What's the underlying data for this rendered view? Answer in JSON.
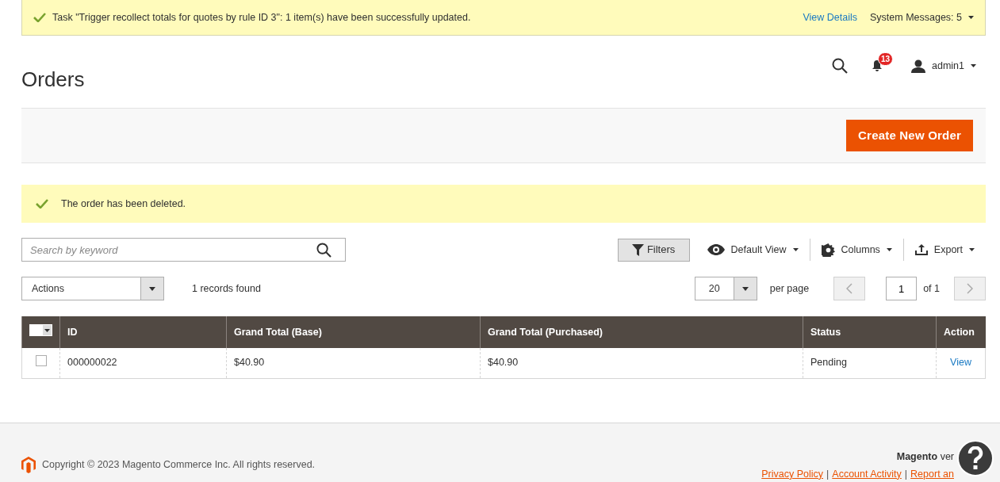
{
  "system_message": {
    "text": "Task \"Trigger recollect totals for quotes by rule ID 3\": 1 item(s) have been successfully updated.",
    "link": "View Details",
    "count_label": "System Messages: 5"
  },
  "header": {
    "title": "Orders",
    "notifications": "13",
    "user": "admin1"
  },
  "page_actions": [
    {
      "label": "Create New Order"
    }
  ],
  "message": {
    "text": "The order has been deleted."
  },
  "search": {
    "placeholder": "Search by keyword"
  },
  "toolbar": {
    "filters": "Filters",
    "view": "Default View",
    "columns": "Columns",
    "export": "Export"
  },
  "mass_action": {
    "value": "Actions"
  },
  "records_found": "1 records found",
  "pagination": {
    "per_page": "20",
    "per_page_label": "per page",
    "page": "1",
    "total_label": "of 1"
  },
  "table": {
    "columns": [
      "ID",
      "Grand Total (Base)",
      "Grand Total (Purchased)",
      "Status",
      "Action"
    ],
    "rows": [
      {
        "checked": false,
        "cells": [
          "000000022",
          "$40.90",
          "$40.90",
          "Pending"
        ],
        "action": "View"
      }
    ]
  },
  "footer": {
    "copyright": "Copyright © 2023 Magento Commerce Inc. All rights reserved.",
    "brand": "Magento",
    "version": "ver",
    "links": [
      "Privacy Policy",
      "Account Activity",
      "Report an"
    ],
    "separators": [
      "|",
      "|"
    ]
  }
}
